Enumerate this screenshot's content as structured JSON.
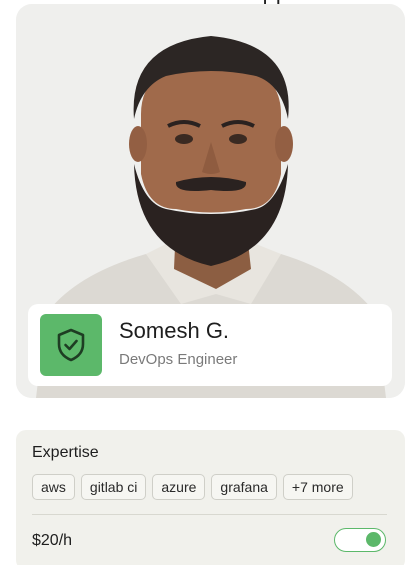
{
  "profile": {
    "top_partial_text": "ı ı",
    "name": "Somesh G.",
    "role": "DevOps Engineer",
    "badge_icon": "shield-check-icon"
  },
  "expertise": {
    "label": "Expertise",
    "tags": [
      "aws",
      "gitlab ci",
      "azure",
      "grafana",
      "+7 more"
    ]
  },
  "rate": {
    "label": "$20/h",
    "toggle_on": true
  },
  "colors": {
    "accent_green": "#5cb86a",
    "card_bg": "#f1f1ec"
  }
}
